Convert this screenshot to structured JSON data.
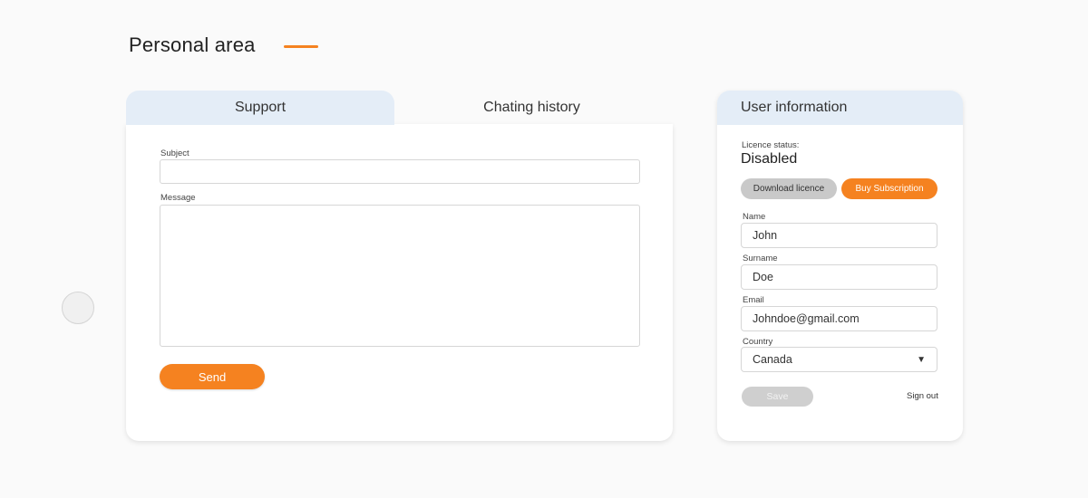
{
  "header": {
    "title": "Personal area",
    "accent_color": "#f58220"
  },
  "support": {
    "tabs": [
      {
        "label": "Support",
        "active": true
      },
      {
        "label": "Chating history",
        "active": false
      }
    ],
    "subject_label": "Subject",
    "subject_value": "",
    "message_label": "Message",
    "message_value": "",
    "send_label": "Send"
  },
  "user_info": {
    "title": "User information",
    "licence_status_label": "Licence status:",
    "licence_status_value": "Disabled",
    "download_licence_label": "Download licence",
    "buy_subscription_label": "Buy Subscription",
    "fields": {
      "name_label": "Name",
      "name_value": "John",
      "surname_label": "Surname",
      "surname_value": "Doe",
      "email_label": "Email",
      "email_value": "Johndoe@gmail.com",
      "country_label": "Country",
      "country_value": "Canada"
    },
    "save_label": "Save",
    "sign_out_label": "Sign out"
  },
  "colors": {
    "accent": "#f58220",
    "tab_background": "#e4edf7",
    "disabled_button": "#cfcfcf"
  },
  "icons": {
    "country_dropdown": "chevron-down-icon"
  }
}
